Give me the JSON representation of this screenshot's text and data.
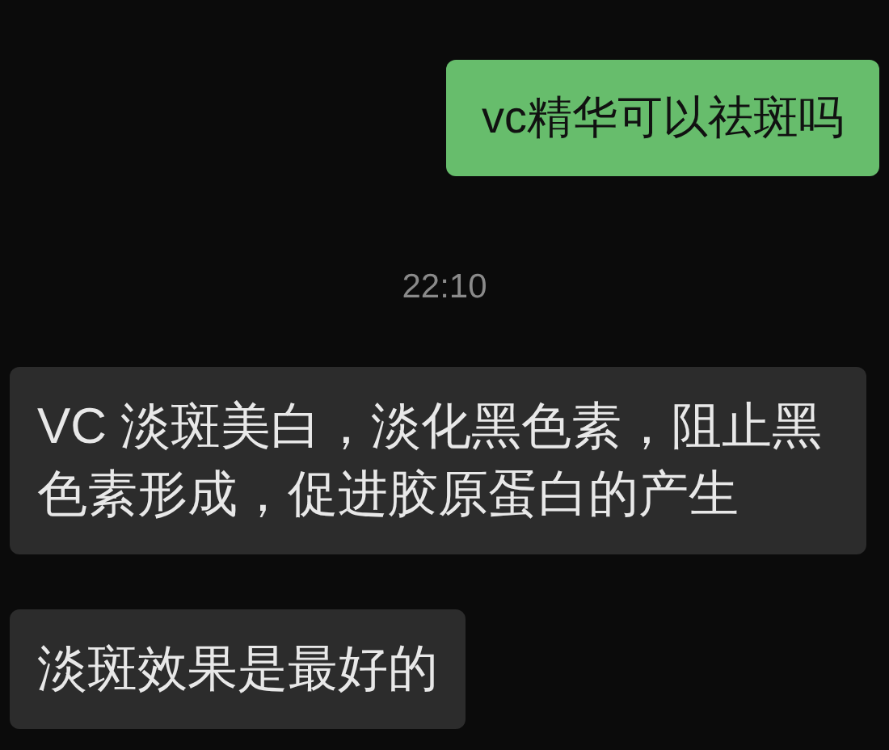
{
  "messages": [
    {
      "kind": "sent",
      "text": "vc精华可以祛斑吗"
    },
    {
      "kind": "time",
      "text": "22:10"
    },
    {
      "kind": "received",
      "text": "VC 淡斑美白，淡化黑色素，阻止黑色素形成，促进胶原蛋白的产生"
    },
    {
      "kind": "received",
      "text": "淡斑效果是最好的"
    }
  ]
}
